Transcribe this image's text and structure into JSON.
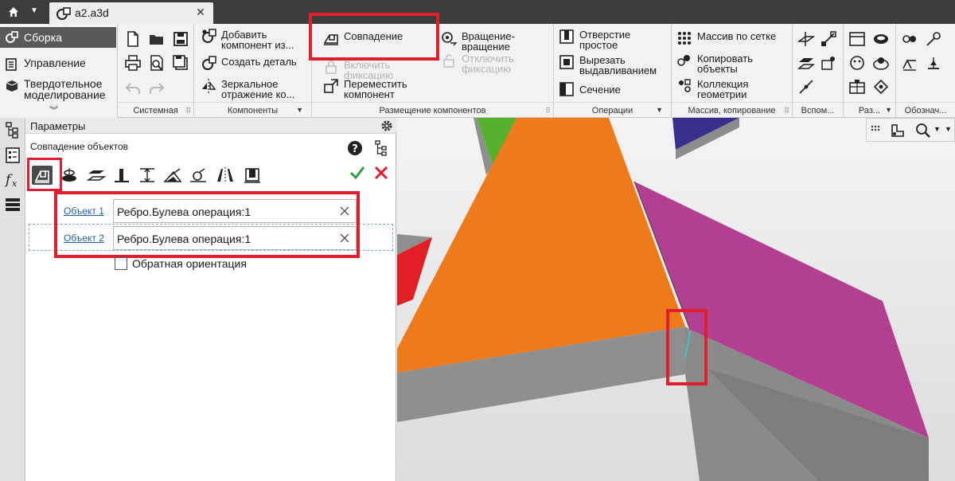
{
  "document": {
    "tab_name": "a2.a3d"
  },
  "modes": [
    {
      "label": "Сборка",
      "icon": "assembly-icon",
      "active": true
    },
    {
      "label": "Управление",
      "icon": "management-icon"
    },
    {
      "label": "Твердотельное моделирование",
      "label_line1": "Твердотельное",
      "label_line2": "моделирование",
      "icon": "solid-modeling-icon"
    }
  ],
  "ribbon": {
    "groups": {
      "system": "Системная",
      "components": "Компоненты",
      "placement": "Размещение компонентов",
      "operations": "Операции",
      "arrays": "Массив, копирование",
      "aux": "Вспом...",
      "sections": "Раз...",
      "notation": "Обознач..."
    },
    "commands": {
      "add_component_1": "Добавить",
      "add_component_2": "компонент из...",
      "create_part": "Создать деталь",
      "mirror_1": "Зеркальное",
      "mirror_2": "отражение ко...",
      "coincidence": "Совпадение",
      "enable_fix_1": "Включить",
      "enable_fix_2": "фиксацию",
      "move_1": "Переместить",
      "move_2": "компонент",
      "rotation_1": "Вращение-",
      "rotation_2": "вращение",
      "disable_fix_1": "Отключить",
      "disable_fix_2": "фиксацию",
      "hole_1": "Отверстие",
      "hole_2": "простое",
      "cut_extrude_1": "Вырезать",
      "cut_extrude_2": "выдавливанием",
      "section": "Сечение",
      "grid_array": "Массив по сетке",
      "copy_objects_1": "Копировать",
      "copy_objects_2": "объекты",
      "geometry_collection_1": "Коллекция",
      "geometry_collection_2": "геометрии"
    }
  },
  "panel": {
    "title": "Параметры",
    "subtitle": "Совпадение объектов",
    "object1_label": "Объект 1",
    "object1_value": "Ребро.Булева операция:1",
    "object2_label": "Объект 2",
    "object2_value": "Ребро.Булева операция:1",
    "reverse_orientation_label": "Обратная ориентация",
    "reverse_orientation_checked": false
  },
  "colors": {
    "highlight": "#e21d2e",
    "orange": "#ef7a1c",
    "magenta": "#b23f92",
    "red": "#e31e24",
    "green": "#55b02d",
    "navy": "#3a2f8c",
    "side_gray": "#8f8f8f",
    "edge_cyan": "#38c6d6"
  }
}
